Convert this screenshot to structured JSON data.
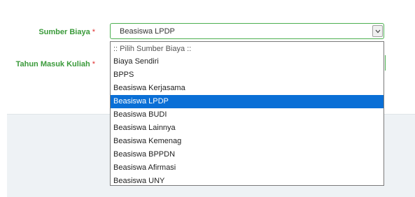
{
  "form": {
    "sumber_biaya": {
      "label": "Sumber Biaya",
      "required_mark": "*",
      "selected_value": "Beasiswa LPDP"
    },
    "tahun_masuk": {
      "label": "Tahun Masuk Kuliah",
      "required_mark": "*"
    }
  },
  "dropdown": {
    "options": [
      ":: Pilih Sumber Biaya ::",
      "Biaya Sendiri",
      "BPPS",
      "Beasiswa Kerjasama",
      "Beasiswa LPDP",
      "Beasiswa BUDI",
      "Beasiswa Lainnya",
      "Beasiswa Kemenag",
      "Beasiswa BPPDN",
      "Beasiswa Afirmasi",
      "Beasiswa UNY"
    ],
    "selected_index": 4
  },
  "colors": {
    "label_green": "#3a9a3a",
    "required_red": "#e03030",
    "focus_border": "#4caf50",
    "selection_blue": "#0a6fd6"
  },
  "icons": {
    "select_arrow": "chevron-down-icon"
  }
}
